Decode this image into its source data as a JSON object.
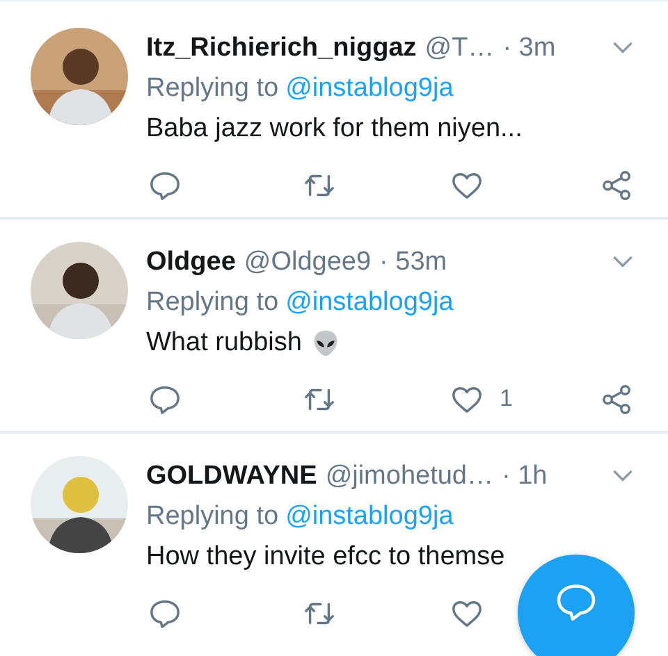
{
  "tweets": [
    {
      "name": "Itz_Richierich_niggaz",
      "handle": "@T…",
      "time": "· 3m",
      "replying_label": "Replying to",
      "replying_to": "@instablog9ja",
      "text": "Baba jazz work for them niyen...",
      "emoji": false,
      "actions": [
        {
          "kind": "reply"
        },
        {
          "kind": "retweet"
        },
        {
          "kind": "like"
        },
        {
          "kind": "share"
        }
      ]
    },
    {
      "name": "Oldgee",
      "handle": "@Oldgee9",
      "time": "· 53m",
      "replying_label": "Replying to",
      "replying_to": "@instablog9ja",
      "text": "What rubbish",
      "emoji": true,
      "actions": [
        {
          "kind": "reply"
        },
        {
          "kind": "retweet"
        },
        {
          "kind": "like",
          "count": "1"
        },
        {
          "kind": "share"
        }
      ]
    },
    {
      "name": "GOLDWAYNE",
      "handle": "@jimohetud…",
      "time": "· 1h",
      "replying_label": "Replying to",
      "replying_to": "@instablog9ja",
      "text": "How they invite efcc to themse",
      "emoji": false,
      "actions": [
        {
          "kind": "reply"
        },
        {
          "kind": "retweet"
        },
        {
          "kind": "like"
        }
      ]
    }
  ],
  "compose_button": {
    "kind": "reply"
  }
}
